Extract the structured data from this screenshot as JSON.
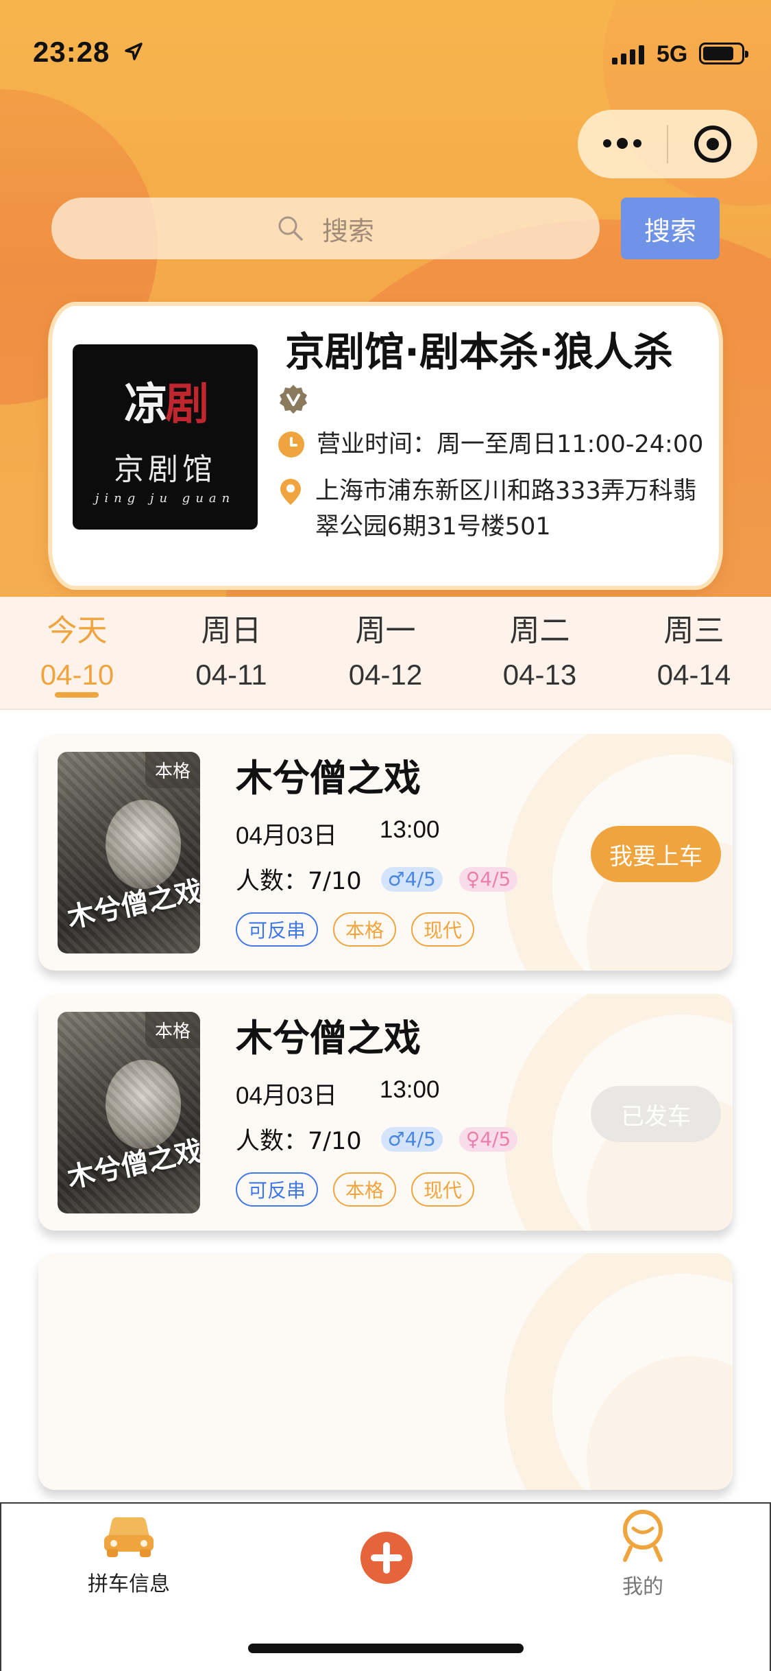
{
  "status_bar": {
    "time": "23:28",
    "network": "5G",
    "battery_level": 0.8
  },
  "search": {
    "placeholder": "搜索",
    "button_label": "搜索"
  },
  "shop": {
    "logo_char_main": "凉",
    "logo_char_accent": "剧",
    "logo_text": "京剧馆",
    "logo_subtext": "jing ju guan",
    "name": "京剧馆·剧本杀·狼人杀",
    "hours": "营业时间：周一至周日11:00-24:00",
    "address": "上海市浦东新区川和路333弄万科翡翠公园6期31号楼501"
  },
  "date_tabs": [
    {
      "weekday": "今天",
      "date": "04-10",
      "active": true
    },
    {
      "weekday": "周日",
      "date": "04-11",
      "active": false
    },
    {
      "weekday": "周一",
      "date": "04-12",
      "active": false
    },
    {
      "weekday": "周二",
      "date": "04-13",
      "active": false
    },
    {
      "weekday": "周三",
      "date": "04-14",
      "active": false
    }
  ],
  "games": [
    {
      "title": "木兮僧之戏",
      "poster_badge": "本格",
      "poster_title": "木兮僧之戏",
      "date": "04月03日",
      "time": "13:00",
      "people_label": "人数：7/10",
      "male": "♂4/5",
      "female": "♀4/5",
      "tags": [
        "可反串",
        "本格",
        "现代"
      ],
      "action": "我要上车"
    },
    {
      "title": "木兮僧之戏",
      "poster_badge": "本格",
      "poster_title": "木兮僧之戏",
      "date": "04月03日",
      "time": "13:00",
      "people_label": "人数：7/10",
      "male": "♂4/5",
      "female": "♀4/5",
      "tags": [
        "可反串",
        "本格",
        "现代"
      ],
      "action": "已发车"
    }
  ],
  "tabbar": {
    "items": [
      {
        "label": "拼车信息",
        "icon": "car-icon"
      },
      {
        "label": "",
        "icon": "add-icon"
      },
      {
        "label": "我的",
        "icon": "profile-icon"
      }
    ]
  },
  "colors": {
    "accent": "#f0a43e",
    "search_button": "#6f93e6",
    "tag_blue": "#3f77e6",
    "male": "#4a86e0",
    "female": "#ea7fae"
  }
}
